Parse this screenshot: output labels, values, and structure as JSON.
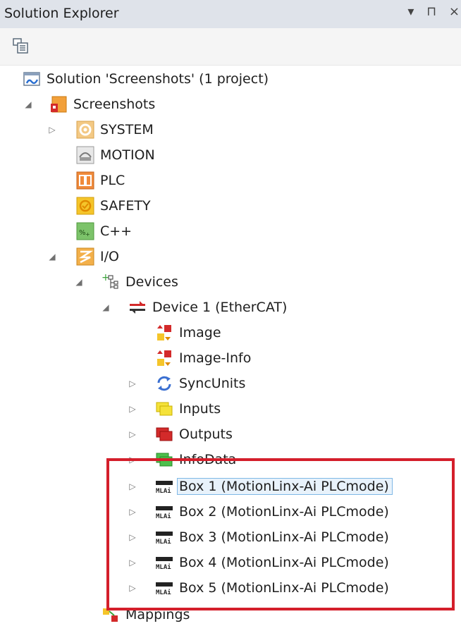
{
  "panel": {
    "title": "Solution Explorer",
    "controls": "▾ ⊓ ×"
  },
  "tree": {
    "solution": "Solution 'Screenshots' (1 project)",
    "project": "Screenshots",
    "system": "SYSTEM",
    "motion": "MOTION",
    "plc": "PLC",
    "safety": "SAFETY",
    "cpp": "C++",
    "io": "I/O",
    "devices": "Devices",
    "device1": "Device 1 (EtherCAT)",
    "image": "Image",
    "image_info": "Image-Info",
    "syncunits": "SyncUnits",
    "inputs": "Inputs",
    "outputs": "Outputs",
    "infodata": "InfoData",
    "box1": "Box 1 (MotionLinx-Ai PLCmode)",
    "box2": "Box 2 (MotionLinx-Ai PLCmode)",
    "box3": "Box 3 (MotionLinx-Ai PLCmode)",
    "box4": "Box 4 (MotionLinx-Ai PLCmode)",
    "box5": "Box 5 (MotionLinx-Ai PLCmode)",
    "mappings": "Mappings"
  },
  "box_icon_text": "MLAi",
  "colors": {
    "highlight": "#d41f2b",
    "selection_border": "#7fb8e6",
    "selection_bg": "#e8f2fb",
    "titlebar": "#dfe3ea"
  }
}
